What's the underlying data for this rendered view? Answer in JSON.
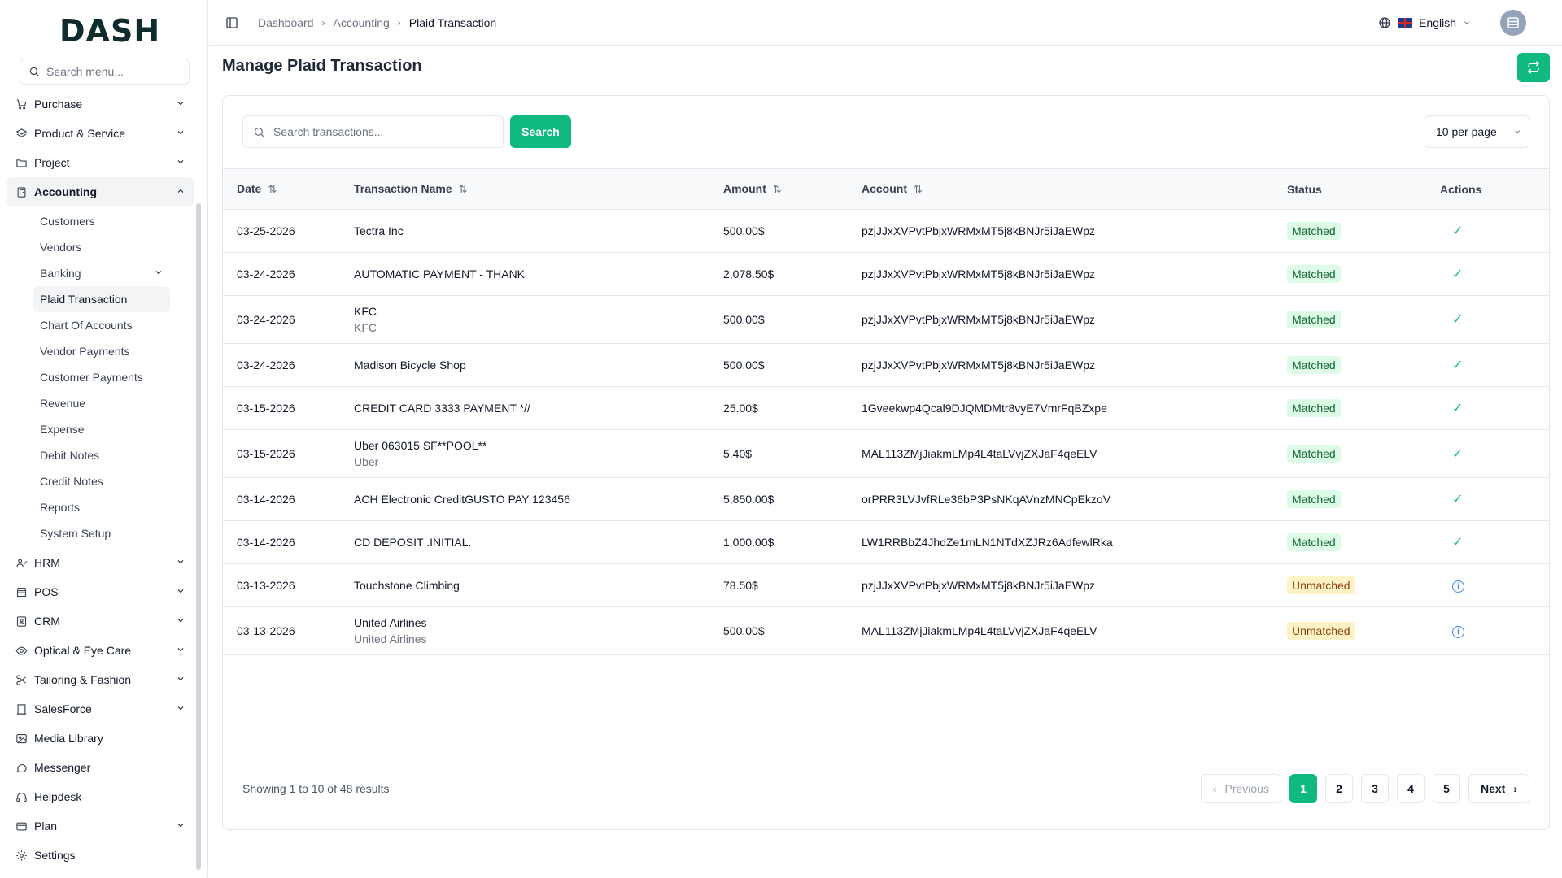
{
  "brand": {
    "logo_text": "DASH"
  },
  "sidebar": {
    "search_placeholder": "Search menu...",
    "items": [
      {
        "label": "Purchase",
        "icon": "cart-icon",
        "expandable": true
      },
      {
        "label": "Product & Service",
        "icon": "layers-icon",
        "expandable": true
      },
      {
        "label": "Project",
        "icon": "folder-icon",
        "expandable": true
      },
      {
        "label": "Accounting",
        "icon": "calculator-icon",
        "expandable": true,
        "expanded": true
      }
    ],
    "accounting_sub": [
      "Customers",
      "Vendors",
      "Banking",
      "Plaid Transaction",
      "Chart Of Accounts",
      "Vendor Payments",
      "Customer Payments",
      "Revenue",
      "Expense",
      "Debit Notes",
      "Credit Notes",
      "Reports",
      "System Setup"
    ],
    "items_after": [
      {
        "label": "HRM",
        "icon": "users-icon",
        "expandable": true
      },
      {
        "label": "POS",
        "icon": "store-icon",
        "expandable": true
      },
      {
        "label": "CRM",
        "icon": "contact-icon",
        "expandable": true
      },
      {
        "label": "Optical & Eye Care",
        "icon": "eye-icon",
        "expandable": true
      },
      {
        "label": "Tailoring & Fashion",
        "icon": "scissors-icon",
        "expandable": true
      },
      {
        "label": "SalesForce",
        "icon": "building-icon",
        "expandable": true
      },
      {
        "label": "Media Library",
        "icon": "image-icon",
        "expandable": false
      },
      {
        "label": "Messenger",
        "icon": "chat-icon",
        "expandable": false
      },
      {
        "label": "Helpdesk",
        "icon": "headset-icon",
        "expandable": false
      },
      {
        "label": "Plan",
        "icon": "card-icon",
        "expandable": true
      },
      {
        "label": "Settings",
        "icon": "gear-icon",
        "expandable": false
      }
    ]
  },
  "topbar": {
    "breadcrumbs": [
      "Dashboard",
      "Accounting",
      "Plaid Transaction"
    ],
    "language": "English"
  },
  "page": {
    "title": "Manage Plaid Transaction",
    "search_placeholder": "Search transactions...",
    "search_button": "Search",
    "per_page": "10 per page"
  },
  "table": {
    "columns": [
      "Date",
      "Transaction Name",
      "Amount",
      "Account",
      "Status",
      "Actions"
    ],
    "rows": [
      {
        "date": "03-25-2026",
        "name": "Tectra Inc",
        "sub": "",
        "amount": "500.00$",
        "account": "pzjJJxXVPvtPbjxWRMxMT5j8kBNJr5iJaEWpz",
        "status": "Matched"
      },
      {
        "date": "03-24-2026",
        "name": "AUTOMATIC PAYMENT - THANK",
        "sub": "",
        "amount": "2,078.50$",
        "account": "pzjJJxXVPvtPbjxWRMxMT5j8kBNJr5iJaEWpz",
        "status": "Matched"
      },
      {
        "date": "03-24-2026",
        "name": "KFC",
        "sub": "KFC",
        "amount": "500.00$",
        "account": "pzjJJxXVPvtPbjxWRMxMT5j8kBNJr5iJaEWpz",
        "status": "Matched"
      },
      {
        "date": "03-24-2026",
        "name": "Madison Bicycle Shop",
        "sub": "",
        "amount": "500.00$",
        "account": "pzjJJxXVPvtPbjxWRMxMT5j8kBNJr5iJaEWpz",
        "status": "Matched"
      },
      {
        "date": "03-15-2026",
        "name": "CREDIT CARD 3333 PAYMENT *//",
        "sub": "",
        "amount": "25.00$",
        "account": "1Gveekwp4Qcal9DJQMDMtr8vyE7VmrFqBZxpe",
        "status": "Matched"
      },
      {
        "date": "03-15-2026",
        "name": "Uber 063015 SF**POOL**",
        "sub": "Uber",
        "amount": "5.40$",
        "account": "MAL113ZMjJiakmLMp4L4taLVvjZXJaF4qeELV",
        "status": "Matched"
      },
      {
        "date": "03-14-2026",
        "name": "ACH Electronic CreditGUSTO PAY 123456",
        "sub": "",
        "amount": "5,850.00$",
        "account": "orPRR3LVJvfRLe36bP3PsNKqAVnzMNCpEkzoV",
        "status": "Matched"
      },
      {
        "date": "03-14-2026",
        "name": "CD DEPOSIT .INITIAL.",
        "sub": "",
        "amount": "1,000.00$",
        "account": "LW1RRBbZ4JhdZe1mLN1NTdXZJRz6AdfewlRka",
        "status": "Matched"
      },
      {
        "date": "03-13-2026",
        "name": "Touchstone Climbing",
        "sub": "",
        "amount": "78.50$",
        "account": "pzjJJxXVPvtPbjxWRMxMT5j8kBNJr5iJaEWpz",
        "status": "Unmatched"
      },
      {
        "date": "03-13-2026",
        "name": "United Airlines",
        "sub": "United Airlines",
        "amount": "500.00$",
        "account": "MAL113ZMjJiakmLMp4L4taLVvjZXJaF4qeELV",
        "status": "Unmatched"
      }
    ]
  },
  "pagination": {
    "summary": "Showing 1 to 10 of 48 results",
    "previous": "Previous",
    "next": "Next",
    "pages": [
      "1",
      "2",
      "3",
      "4",
      "5"
    ],
    "current": "1"
  },
  "colors": {
    "accent": "#10b981",
    "matched_bg": "#dcfce7",
    "unmatched_bg": "#fef3c7"
  }
}
